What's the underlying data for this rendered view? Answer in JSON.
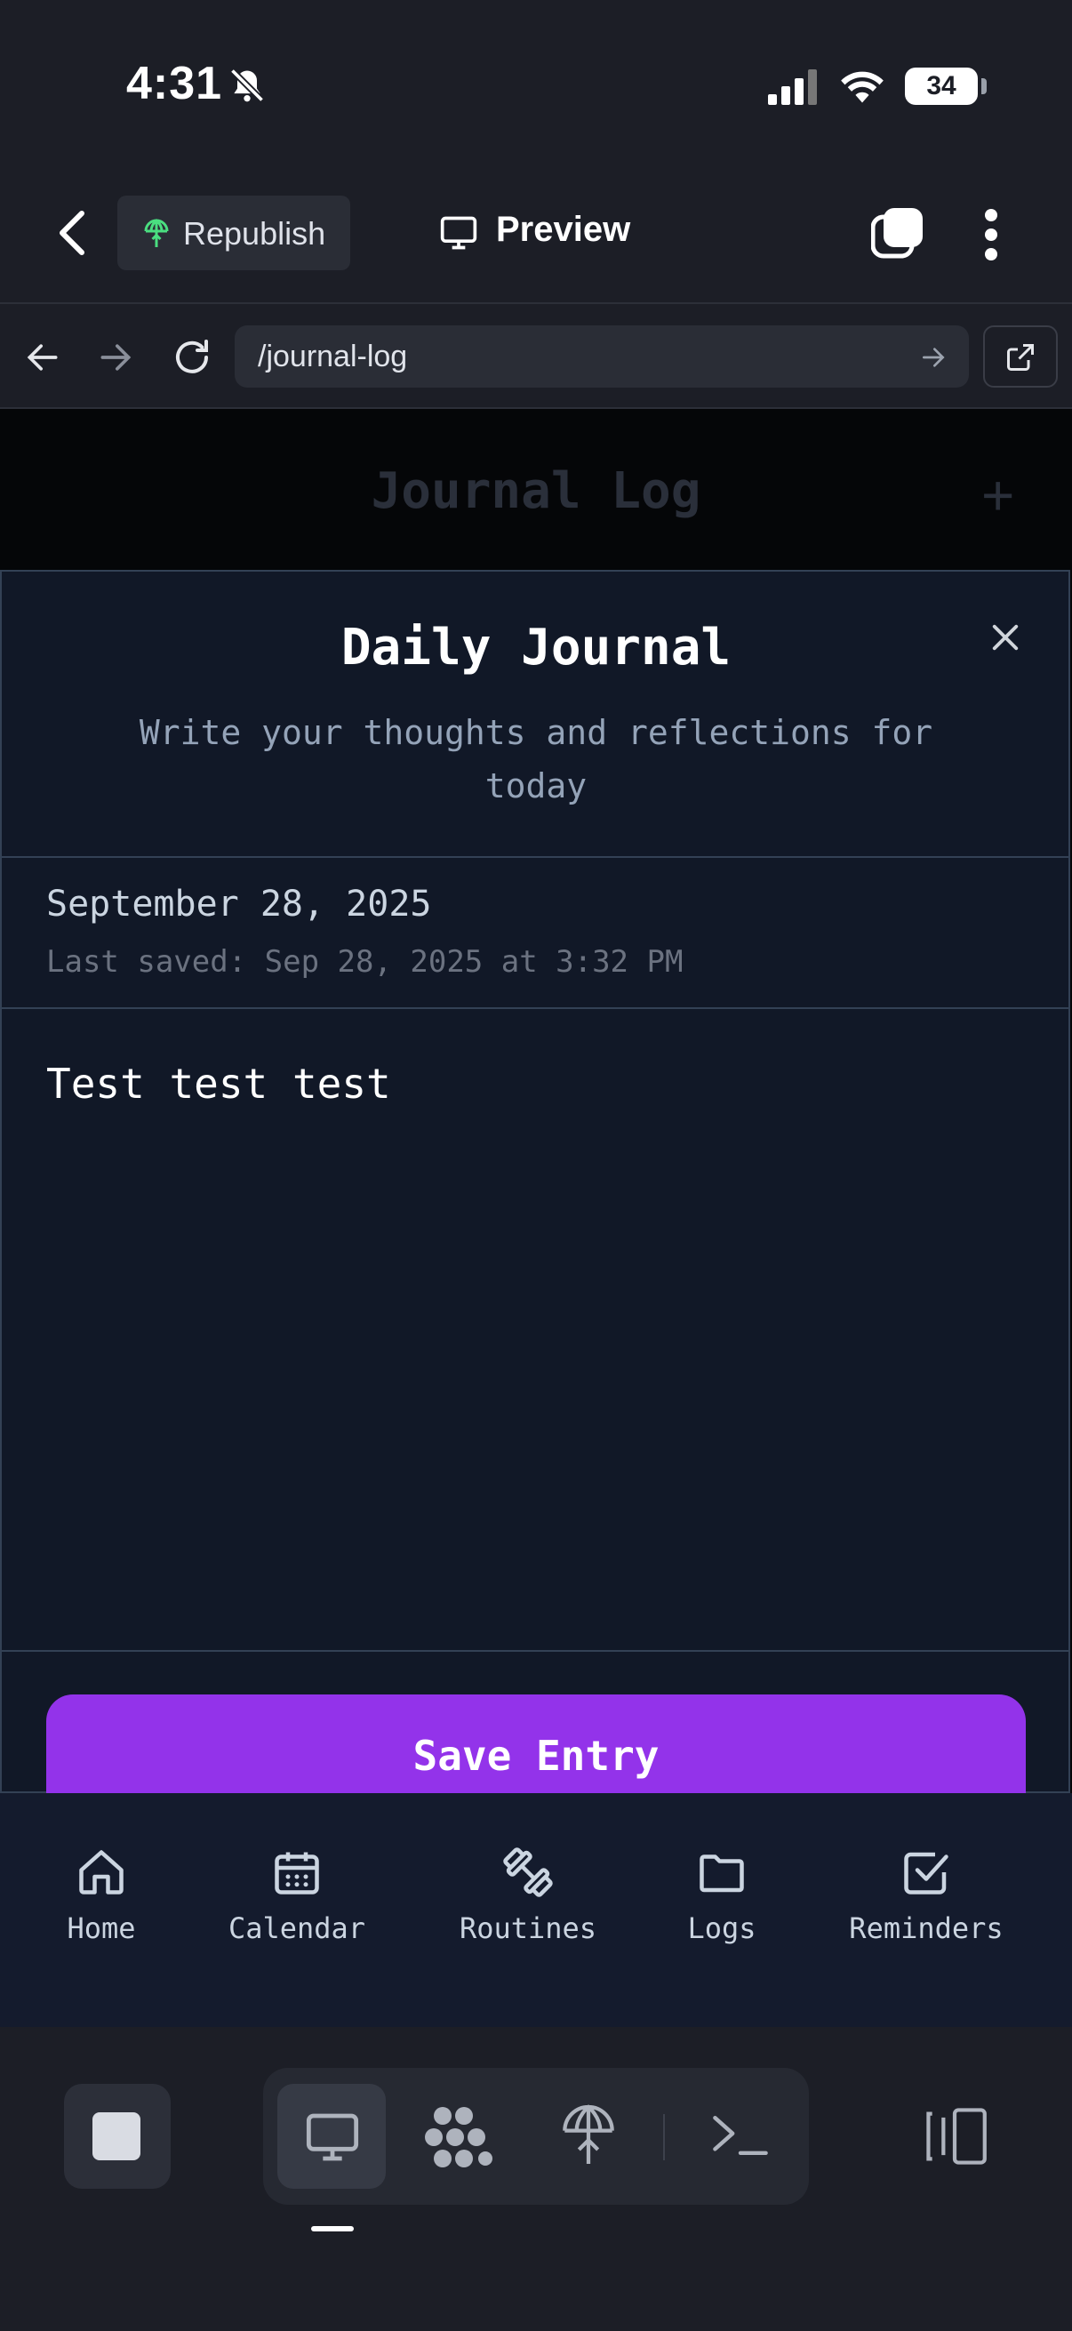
{
  "status_bar": {
    "time": "4:31",
    "battery": "34"
  },
  "app_bar": {
    "republish_label": "Republish",
    "preview_label": "Preview"
  },
  "browser": {
    "url": "/journal-log"
  },
  "page": {
    "title": "Journal Log"
  },
  "modal": {
    "title": "Daily Journal",
    "subtitle": "Write your thoughts and reflections for today",
    "date": "September 28, 2025",
    "last_saved": "Last saved: Sep 28, 2025 at 3:32 PM",
    "entry_text": "Test test test",
    "save_label": "Save Entry"
  },
  "bottom_nav": [
    {
      "label": "Home",
      "icon": "home-icon"
    },
    {
      "label": "Calendar",
      "icon": "calendar-icon"
    },
    {
      "label": "Routines",
      "icon": "dumbbell-icon"
    },
    {
      "label": "Logs",
      "icon": "folder-icon"
    },
    {
      "label": "Reminders",
      "icon": "checkbox-icon"
    }
  ],
  "colors": {
    "accent": "#9333ea",
    "modal_bg": "#111827",
    "border": "#334155"
  }
}
